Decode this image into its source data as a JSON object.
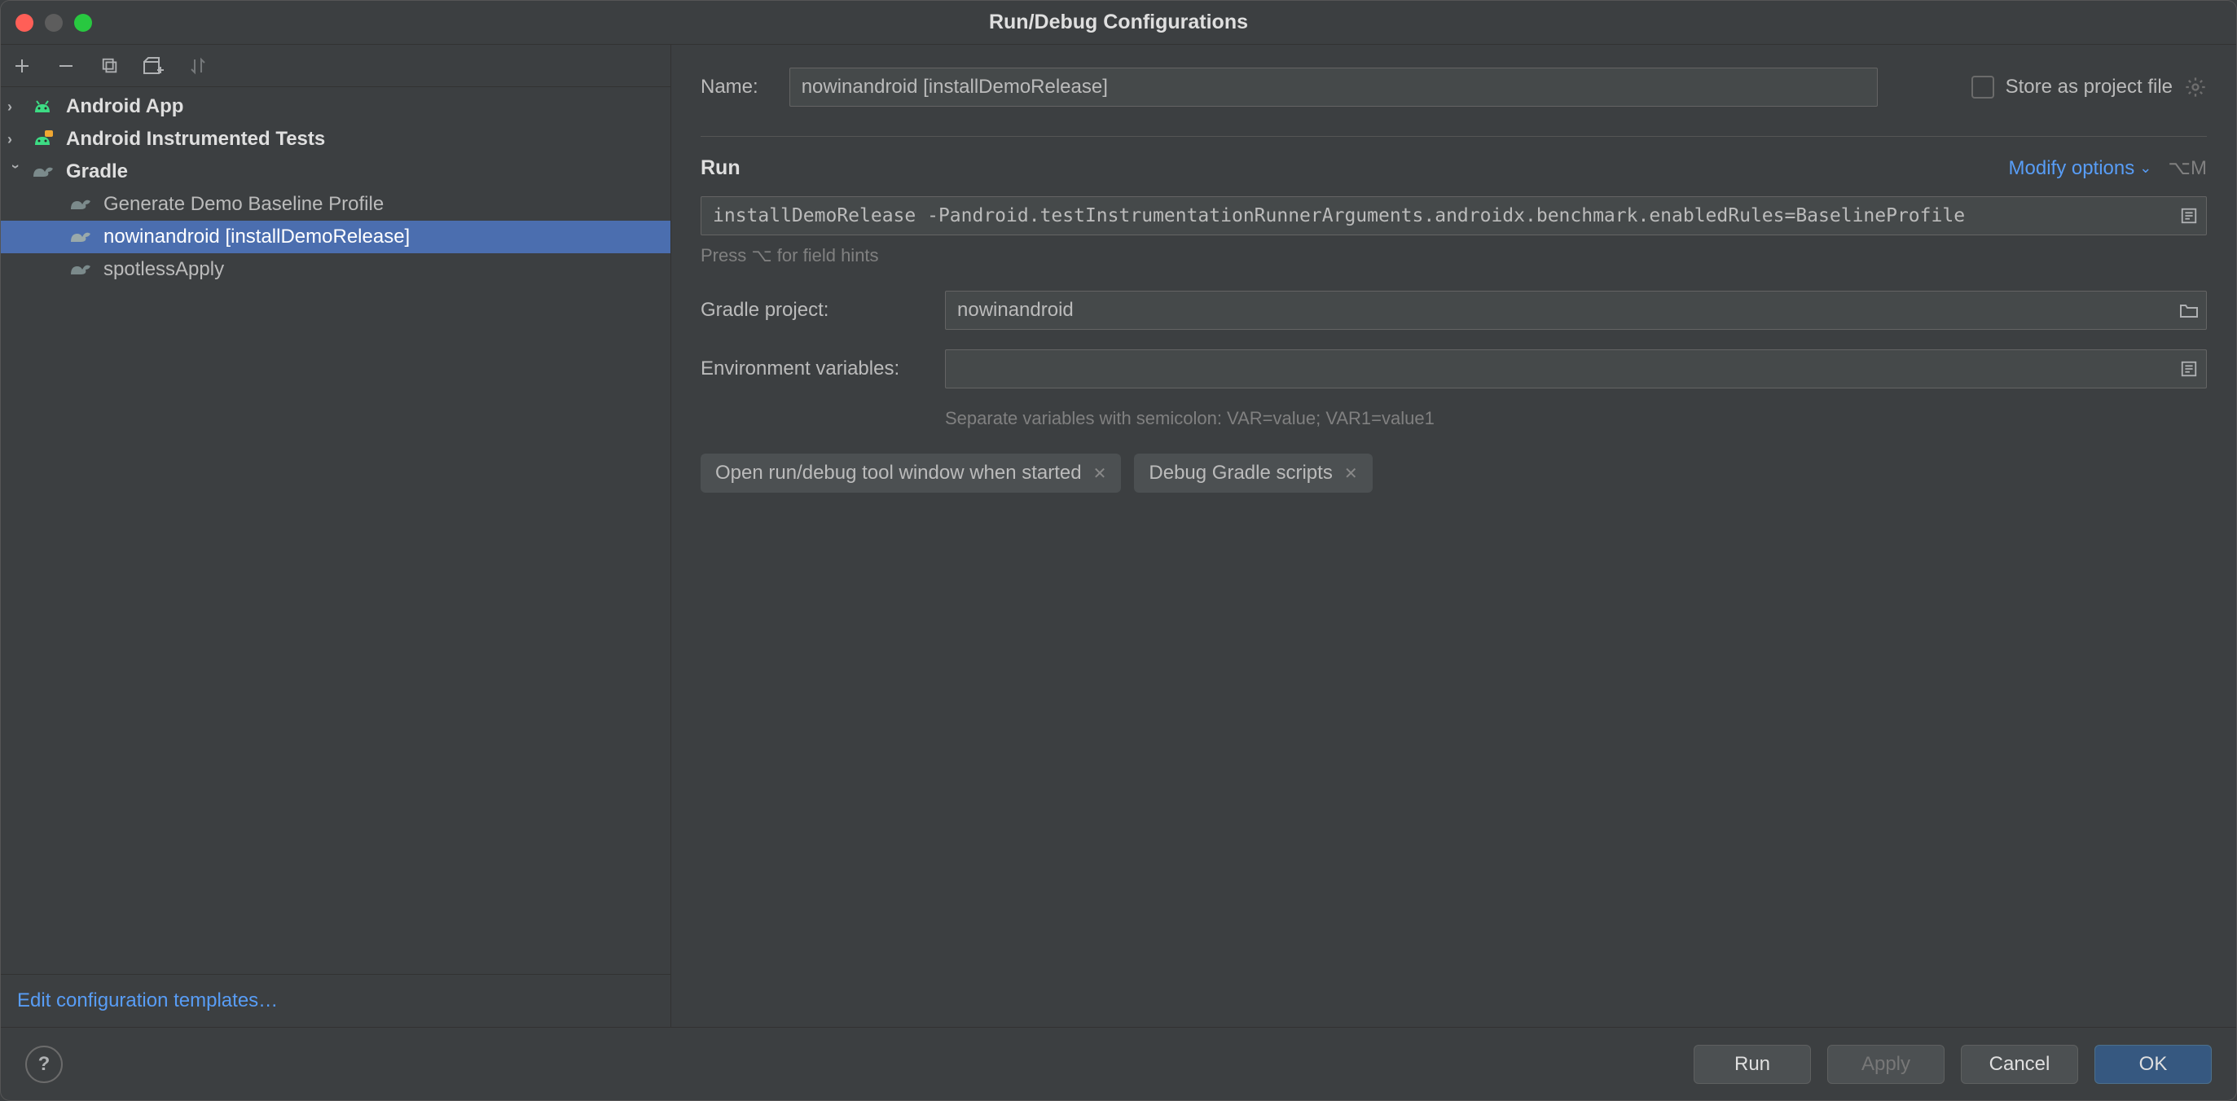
{
  "window": {
    "title": "Run/Debug Configurations"
  },
  "sidebar": {
    "nodes": [
      {
        "label": "Android App",
        "expanded": false,
        "type": "android"
      },
      {
        "label": "Android Instrumented Tests",
        "expanded": false,
        "type": "android-tests"
      },
      {
        "label": "Gradle",
        "expanded": true,
        "type": "gradle",
        "children": [
          {
            "label": "Generate Demo Baseline Profile",
            "selected": false
          },
          {
            "label": "nowinandroid [installDemoRelease]",
            "selected": true
          },
          {
            "label": "spotlessApply",
            "selected": false
          }
        ]
      }
    ],
    "edit_templates": "Edit configuration templates…"
  },
  "form": {
    "name_label": "Name:",
    "name_value": "nowinandroid [installDemoRelease]",
    "store_label": "Store as project file",
    "store_checked": false,
    "section": "Run",
    "modify": "Modify options",
    "modify_shortcut": "⌥M",
    "tasks_value": "installDemoRelease -Pandroid.testInstrumentationRunnerArguments.androidx.benchmark.enabledRules=BaselineProfile",
    "tasks_hint": "Press ⌥ for field hints",
    "project_label": "Gradle project:",
    "project_value": "nowinandroid",
    "env_label": "Environment variables:",
    "env_value": "",
    "env_hint": "Separate variables with semicolon: VAR=value; VAR1=value1",
    "tags": [
      "Open run/debug tool window when started",
      "Debug Gradle scripts"
    ]
  },
  "footer": {
    "run": "Run",
    "apply": "Apply",
    "cancel": "Cancel",
    "ok": "OK"
  }
}
